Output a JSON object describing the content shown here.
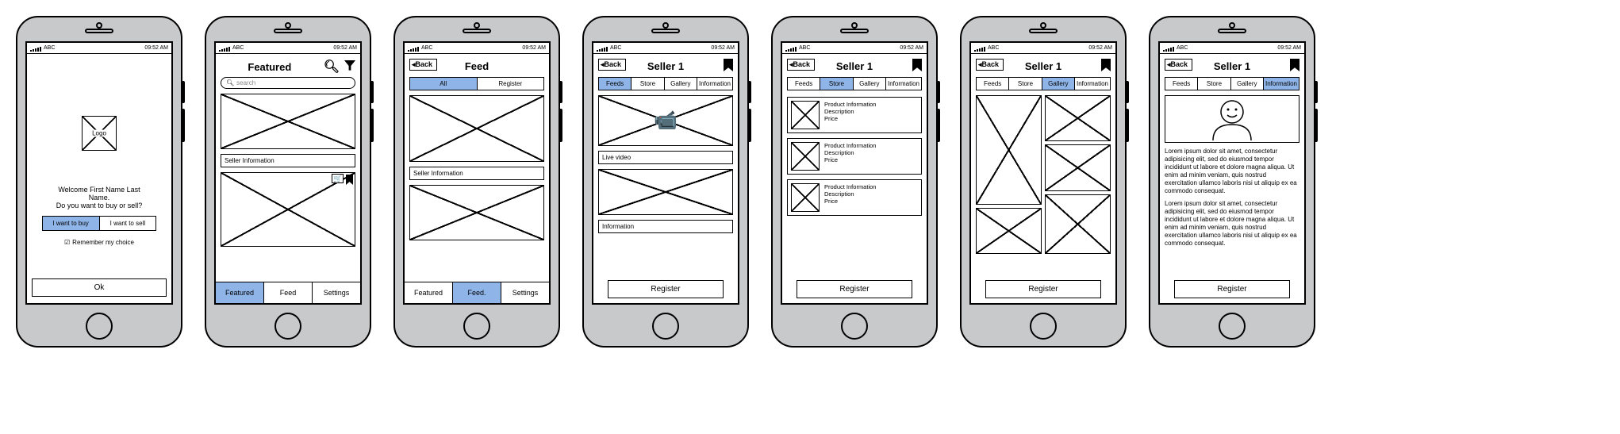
{
  "status": {
    "carrier": "ABC",
    "time": "09:52 AM"
  },
  "welcome": {
    "logo_label": "Logo",
    "line1": "Welcome First Name Last",
    "line2": "Name.",
    "line3": "Do you want to buy or sell?",
    "buy": "I want to buy",
    "sell": "I want to sell",
    "remember": "Remember my choice",
    "ok": "Ok"
  },
  "featured": {
    "title": "Featured",
    "search_placeholder": "search",
    "seller_info": "Seller Information",
    "nav": {
      "a": "Featured",
      "b": "Feed",
      "c": "Settings"
    }
  },
  "feed": {
    "back": "Back",
    "title": "Feed",
    "tabs": {
      "all": "All",
      "register": "Register"
    },
    "seller_info": "Seller Information",
    "nav": {
      "a": "Featured",
      "b": "Feed.",
      "c": "Settings"
    }
  },
  "seller": {
    "back": "Back",
    "title": "Seller 1",
    "tabs": {
      "feeds": "Feeds",
      "store": "Store",
      "gallery": "Gallery",
      "information": "Information"
    },
    "live": "Live video",
    "info": "Information",
    "register": "Register",
    "product": {
      "a": "Product Information",
      "b": "Description",
      "c": "Price"
    },
    "lorem": "Lorem ipsum dolor sit amet, consectetur adipisicing elit, sed do eiusmod tempor incididunt ut labore et dolore magna aliqua. Ut enim ad minim veniam, quis nostrud exercitation ullamco laboris nisi ut aliquip ex ea commodo consequat."
  }
}
